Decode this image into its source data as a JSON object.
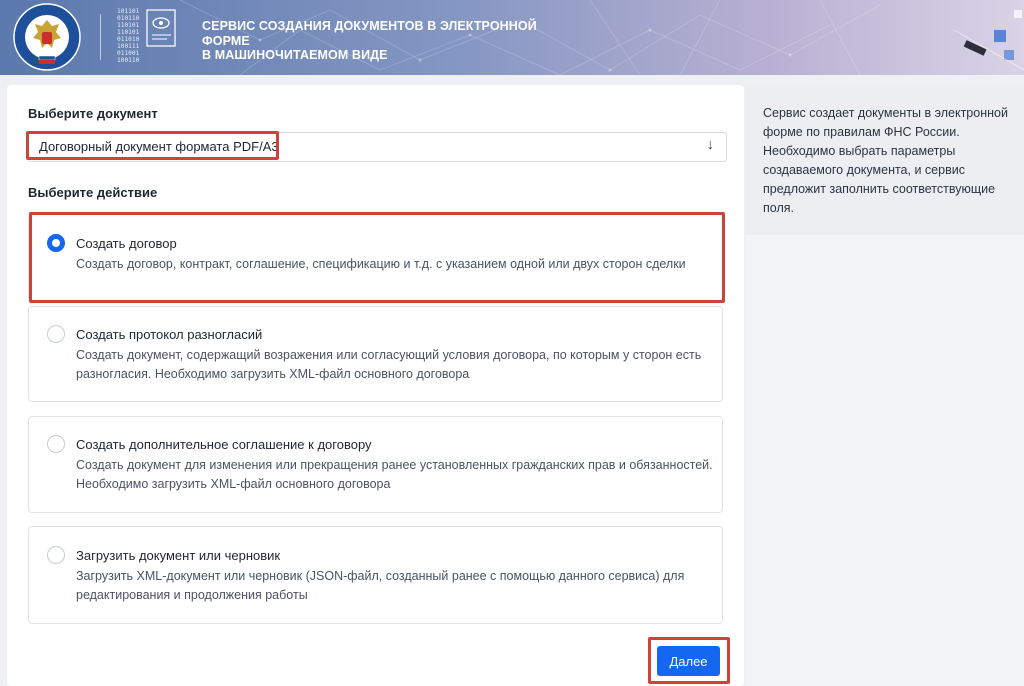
{
  "header": {
    "title_line1": "СЕРВИС СОЗДАНИЯ ДОКУМЕНТОВ В ЭЛЕКТРОННОЙ ФОРМЕ",
    "title_line2": "В МАШИНОЧИТАЕМОМ ВИДЕ",
    "logo_icon": "fns-emblem-icon",
    "service_icon": "binary-document-icon",
    "emblem_text": "ФЕДЕРАЛЬНАЯ НАЛОГОВАЯ СЛУЖБА",
    "bits": "101101\n010110\n110101\n110101\n011010\n100111\n011001\n100110"
  },
  "form": {
    "document_label": "Выберите документ",
    "document_value": "Договорный документ формата PDF/A3",
    "select_arrow": "↓",
    "action_label": "Выберите действие",
    "options": [
      {
        "title": "Создать договор",
        "desc": "Создать договор, контракт, соглашение, спецификацию и т.д. с указанием одной или двух сторон сделки",
        "selected": true
      },
      {
        "title": "Создать протокол разногласий",
        "desc": "Создать документ, содержащий возражения или согласующий условия договора, по которым у сторон есть разногласия. Необходимо загрузить XML-файл основного договора",
        "selected": false
      },
      {
        "title": "Создать дополнительное соглашение к договору",
        "desc": "Создать документ для изменения или прекращения ранее установленных гражданских прав и обязанностей. Необходимо загрузить XML-файл основного договора",
        "selected": false
      },
      {
        "title": "Загрузить документ или черновик",
        "desc": "Загрузить XML-документ или черновик (JSON-файл, созданный ранее с помощью данного сервиса) для редактирования и продолжения работы",
        "selected": false
      }
    ],
    "next_label": "Далее"
  },
  "side": {
    "text": "Сервис создает документы в электронной форме по правилам ФНС России. Необходимо выбрать параметры создаваемого документа, и сервис предложит заполнить соответствующие поля."
  },
  "colors": {
    "accent": "#1566f0",
    "highlight": "#d0413a",
    "header_start": "#5b79ad",
    "header_end": "#d9d3e6"
  }
}
